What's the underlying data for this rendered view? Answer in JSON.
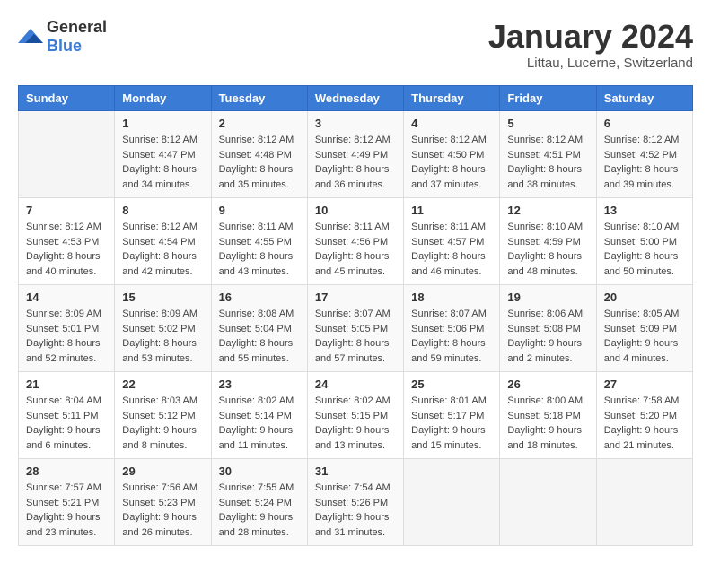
{
  "logo": {
    "general": "General",
    "blue": "Blue"
  },
  "title": "January 2024",
  "location": "Littau, Lucerne, Switzerland",
  "headers": [
    "Sunday",
    "Monday",
    "Tuesday",
    "Wednesday",
    "Thursday",
    "Friday",
    "Saturday"
  ],
  "weeks": [
    [
      {
        "day": "",
        "sunrise": "",
        "sunset": "",
        "daylight": ""
      },
      {
        "day": "1",
        "sunrise": "Sunrise: 8:12 AM",
        "sunset": "Sunset: 4:47 PM",
        "daylight": "Daylight: 8 hours and 34 minutes."
      },
      {
        "day": "2",
        "sunrise": "Sunrise: 8:12 AM",
        "sunset": "Sunset: 4:48 PM",
        "daylight": "Daylight: 8 hours and 35 minutes."
      },
      {
        "day": "3",
        "sunrise": "Sunrise: 8:12 AM",
        "sunset": "Sunset: 4:49 PM",
        "daylight": "Daylight: 8 hours and 36 minutes."
      },
      {
        "day": "4",
        "sunrise": "Sunrise: 8:12 AM",
        "sunset": "Sunset: 4:50 PM",
        "daylight": "Daylight: 8 hours and 37 minutes."
      },
      {
        "day": "5",
        "sunrise": "Sunrise: 8:12 AM",
        "sunset": "Sunset: 4:51 PM",
        "daylight": "Daylight: 8 hours and 38 minutes."
      },
      {
        "day": "6",
        "sunrise": "Sunrise: 8:12 AM",
        "sunset": "Sunset: 4:52 PM",
        "daylight": "Daylight: 8 hours and 39 minutes."
      }
    ],
    [
      {
        "day": "7",
        "sunrise": "Sunrise: 8:12 AM",
        "sunset": "Sunset: 4:53 PM",
        "daylight": "Daylight: 8 hours and 40 minutes."
      },
      {
        "day": "8",
        "sunrise": "Sunrise: 8:12 AM",
        "sunset": "Sunset: 4:54 PM",
        "daylight": "Daylight: 8 hours and 42 minutes."
      },
      {
        "day": "9",
        "sunrise": "Sunrise: 8:11 AM",
        "sunset": "Sunset: 4:55 PM",
        "daylight": "Daylight: 8 hours and 43 minutes."
      },
      {
        "day": "10",
        "sunrise": "Sunrise: 8:11 AM",
        "sunset": "Sunset: 4:56 PM",
        "daylight": "Daylight: 8 hours and 45 minutes."
      },
      {
        "day": "11",
        "sunrise": "Sunrise: 8:11 AM",
        "sunset": "Sunset: 4:57 PM",
        "daylight": "Daylight: 8 hours and 46 minutes."
      },
      {
        "day": "12",
        "sunrise": "Sunrise: 8:10 AM",
        "sunset": "Sunset: 4:59 PM",
        "daylight": "Daylight: 8 hours and 48 minutes."
      },
      {
        "day": "13",
        "sunrise": "Sunrise: 8:10 AM",
        "sunset": "Sunset: 5:00 PM",
        "daylight": "Daylight: 8 hours and 50 minutes."
      }
    ],
    [
      {
        "day": "14",
        "sunrise": "Sunrise: 8:09 AM",
        "sunset": "Sunset: 5:01 PM",
        "daylight": "Daylight: 8 hours and 52 minutes."
      },
      {
        "day": "15",
        "sunrise": "Sunrise: 8:09 AM",
        "sunset": "Sunset: 5:02 PM",
        "daylight": "Daylight: 8 hours and 53 minutes."
      },
      {
        "day": "16",
        "sunrise": "Sunrise: 8:08 AM",
        "sunset": "Sunset: 5:04 PM",
        "daylight": "Daylight: 8 hours and 55 minutes."
      },
      {
        "day": "17",
        "sunrise": "Sunrise: 8:07 AM",
        "sunset": "Sunset: 5:05 PM",
        "daylight": "Daylight: 8 hours and 57 minutes."
      },
      {
        "day": "18",
        "sunrise": "Sunrise: 8:07 AM",
        "sunset": "Sunset: 5:06 PM",
        "daylight": "Daylight: 8 hours and 59 minutes."
      },
      {
        "day": "19",
        "sunrise": "Sunrise: 8:06 AM",
        "sunset": "Sunset: 5:08 PM",
        "daylight": "Daylight: 9 hours and 2 minutes."
      },
      {
        "day": "20",
        "sunrise": "Sunrise: 8:05 AM",
        "sunset": "Sunset: 5:09 PM",
        "daylight": "Daylight: 9 hours and 4 minutes."
      }
    ],
    [
      {
        "day": "21",
        "sunrise": "Sunrise: 8:04 AM",
        "sunset": "Sunset: 5:11 PM",
        "daylight": "Daylight: 9 hours and 6 minutes."
      },
      {
        "day": "22",
        "sunrise": "Sunrise: 8:03 AM",
        "sunset": "Sunset: 5:12 PM",
        "daylight": "Daylight: 9 hours and 8 minutes."
      },
      {
        "day": "23",
        "sunrise": "Sunrise: 8:02 AM",
        "sunset": "Sunset: 5:14 PM",
        "daylight": "Daylight: 9 hours and 11 minutes."
      },
      {
        "day": "24",
        "sunrise": "Sunrise: 8:02 AM",
        "sunset": "Sunset: 5:15 PM",
        "daylight": "Daylight: 9 hours and 13 minutes."
      },
      {
        "day": "25",
        "sunrise": "Sunrise: 8:01 AM",
        "sunset": "Sunset: 5:17 PM",
        "daylight": "Daylight: 9 hours and 15 minutes."
      },
      {
        "day": "26",
        "sunrise": "Sunrise: 8:00 AM",
        "sunset": "Sunset: 5:18 PM",
        "daylight": "Daylight: 9 hours and 18 minutes."
      },
      {
        "day": "27",
        "sunrise": "Sunrise: 7:58 AM",
        "sunset": "Sunset: 5:20 PM",
        "daylight": "Daylight: 9 hours and 21 minutes."
      }
    ],
    [
      {
        "day": "28",
        "sunrise": "Sunrise: 7:57 AM",
        "sunset": "Sunset: 5:21 PM",
        "daylight": "Daylight: 9 hours and 23 minutes."
      },
      {
        "day": "29",
        "sunrise": "Sunrise: 7:56 AM",
        "sunset": "Sunset: 5:23 PM",
        "daylight": "Daylight: 9 hours and 26 minutes."
      },
      {
        "day": "30",
        "sunrise": "Sunrise: 7:55 AM",
        "sunset": "Sunset: 5:24 PM",
        "daylight": "Daylight: 9 hours and 28 minutes."
      },
      {
        "day": "31",
        "sunrise": "Sunrise: 7:54 AM",
        "sunset": "Sunset: 5:26 PM",
        "daylight": "Daylight: 9 hours and 31 minutes."
      },
      {
        "day": "",
        "sunrise": "",
        "sunset": "",
        "daylight": ""
      },
      {
        "day": "",
        "sunrise": "",
        "sunset": "",
        "daylight": ""
      },
      {
        "day": "",
        "sunrise": "",
        "sunset": "",
        "daylight": ""
      }
    ]
  ]
}
